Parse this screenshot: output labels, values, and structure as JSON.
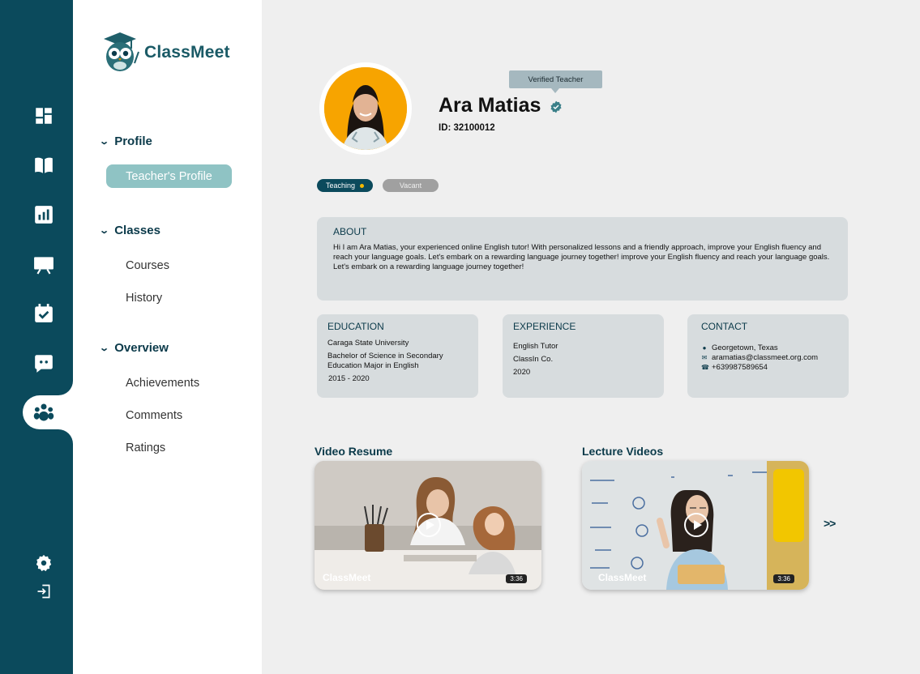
{
  "brand": {
    "name": "ClassMeet"
  },
  "rail_icons": [
    "dashboard-icon",
    "book-icon",
    "chart-icon",
    "presentation-icon",
    "calendar-check-icon",
    "chat-icon",
    "community-icon",
    "settings-icon",
    "logout-icon"
  ],
  "sidebar": {
    "sections": [
      {
        "title": "Profile",
        "items": [
          {
            "label": "Teacher's Profile",
            "active": true
          }
        ]
      },
      {
        "title": "Classes",
        "items": [
          {
            "label": "Courses"
          },
          {
            "label": "History"
          }
        ]
      },
      {
        "title": "Overview",
        "items": [
          {
            "label": "Achievements"
          },
          {
            "label": "Comments"
          },
          {
            "label": "Ratings"
          }
        ]
      }
    ]
  },
  "profile": {
    "verified_label": "Verified Teacher",
    "name": "Ara Matias",
    "id_text": "ID: 32100012",
    "status_teaching": "Teaching",
    "status_vacant": "Vacant"
  },
  "about": {
    "title": "ABOUT",
    "text": "Hi I am Ara Matias, your experienced online English tutor! With personalized lessons and a friendly approach, improve your English fluency and reach your language goals. Let's embark on a rewarding language journey together! improve your English fluency and reach your language goals. Let's embark on a rewarding language journey together!"
  },
  "education": {
    "title": "EDUCATION",
    "school": "Caraga State University",
    "degree_line1": "Bachelor of Science in Secondary",
    "degree_line2": "Education Major in English",
    "years": "2015 - 2020"
  },
  "experience": {
    "title": "EXPERIENCE",
    "role": "English Tutor",
    "company": "ClassIn Co.",
    "year": "2020"
  },
  "contact": {
    "title": "CONTACT",
    "location": "Georgetown, Texas",
    "email": "aramatias@classmeet.org.com",
    "phone": "+639987589654"
  },
  "videos": {
    "resume_title": "Video Resume",
    "lecture_title": "Lecture Videos",
    "brand": "ClassMeet",
    "duration": "3:36",
    "more": ">>"
  },
  "colors": {
    "primary": "#0b4a5c",
    "accent": "#8fc3c4",
    "card": "#d7dcde",
    "avatar_bg": "#f7a400"
  }
}
